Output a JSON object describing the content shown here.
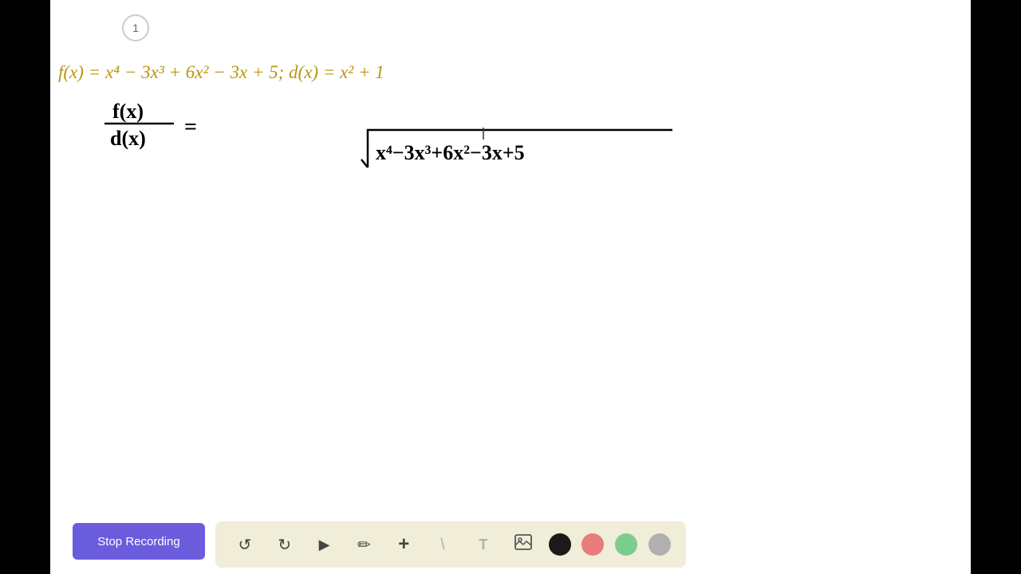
{
  "page": {
    "number": "1",
    "background": "#ffffff"
  },
  "typed_formula": {
    "text": "f(x) = x⁴ − 3x³ + 6x² − 3x + 5; d(x) = x² + 1"
  },
  "handwritten": {
    "fraction_numerator": "f(x)",
    "fraction_denominator": "d(x)",
    "equals": "=",
    "long_division_expression": "x⁴−3x³+6x²−3x+5"
  },
  "toolbar": {
    "undo_label": "↺",
    "redo_label": "↻",
    "select_label": "▲",
    "pen_label": "✏",
    "plus_label": "+",
    "slash_label": "/",
    "text_label": "T",
    "image_label": "🖼",
    "colors": [
      "#1a1a1a",
      "#e87c7c",
      "#7ccc8e",
      "#b0b0b0"
    ]
  },
  "stop_recording": {
    "label": "Stop Recording"
  }
}
